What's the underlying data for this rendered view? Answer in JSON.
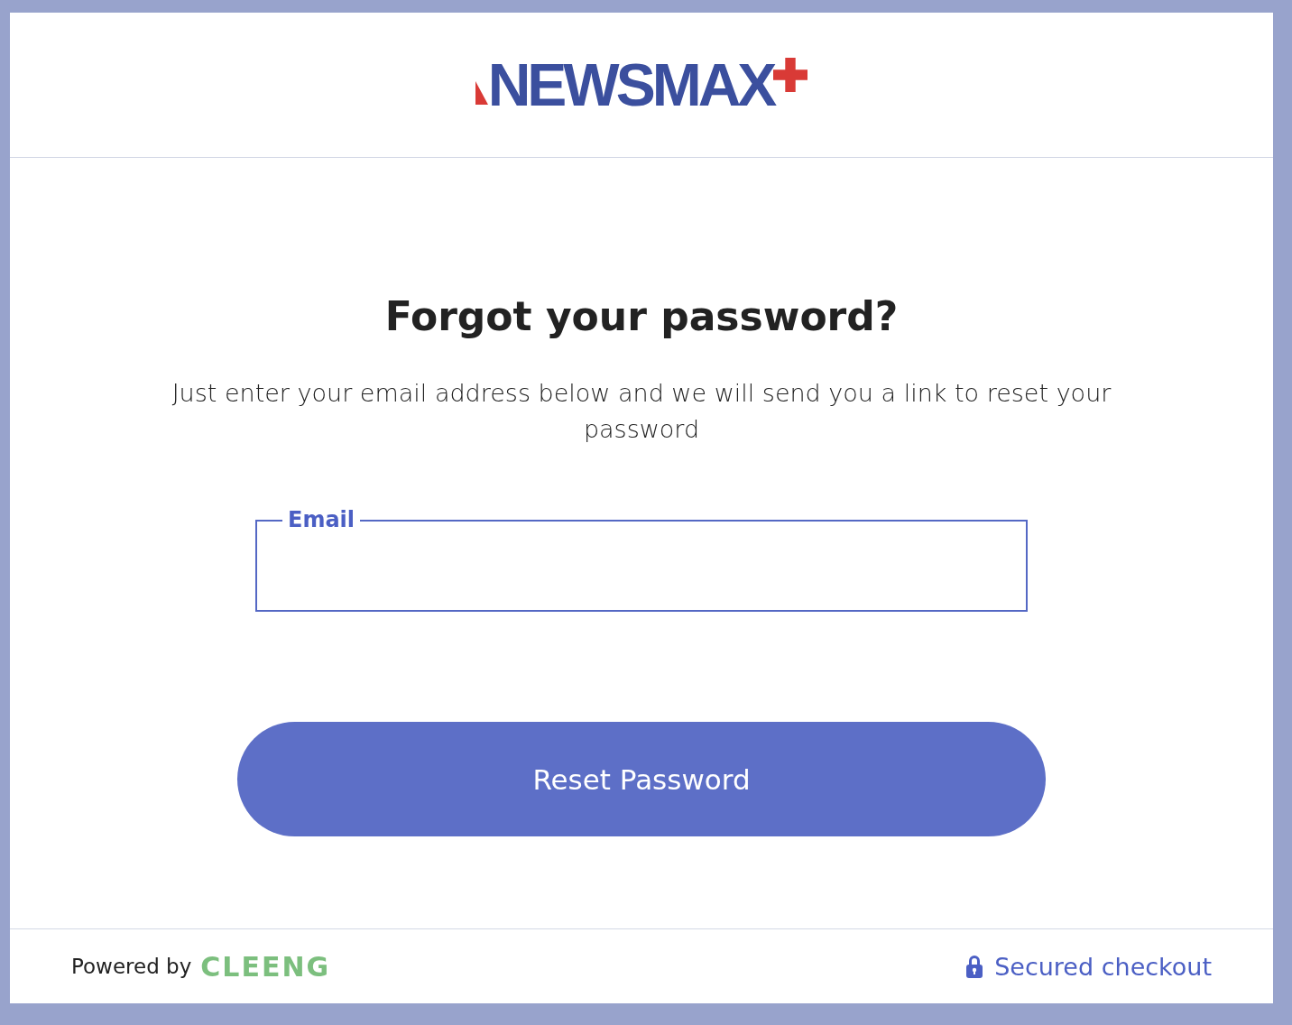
{
  "header": {
    "logo": "NEWSMAX"
  },
  "form": {
    "title": "Forgot your password?",
    "description": "Just enter your email address below and we will send you a link to reset your password",
    "email_field": {
      "label": "Email"
    },
    "submit_button": "Reset Password"
  },
  "footer": {
    "powered_by": "Powered by",
    "brand": "CLEENG",
    "secure_label": "Secured checkout"
  }
}
